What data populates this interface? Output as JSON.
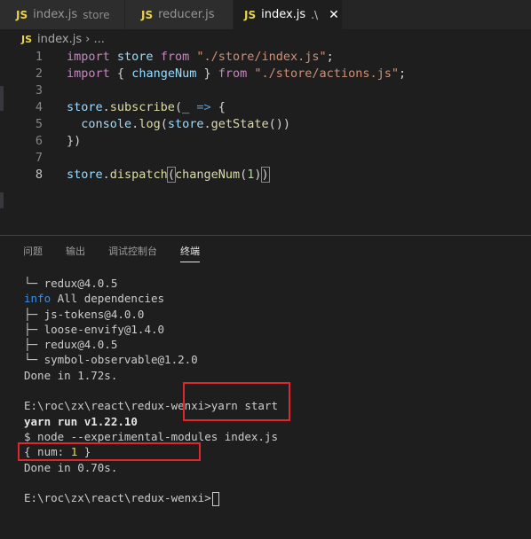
{
  "tabs": [
    {
      "label": "index.js",
      "desc": "store"
    },
    {
      "label": "reducer.js",
      "desc": ""
    },
    {
      "label": "index.js",
      "desc": ".\\"
    }
  ],
  "tab_icon": "JS",
  "close_glyph": "✕",
  "breadcrumb": {
    "file": "index.js",
    "rest": "›  ..."
  },
  "editor": {
    "line_numbers": [
      "1",
      "2",
      "3",
      "4",
      "5",
      "6",
      "7",
      "8"
    ],
    "l1": {
      "kw": "import",
      "var": "store",
      "kw2": "from",
      "str": "\"./store/index.js\"",
      "end": ";"
    },
    "l2": {
      "kw": "import",
      "open": "{ ",
      "fn": "changeNum",
      "close": " }",
      "kw2": "from",
      "str": "\"./store/actions.js\"",
      "end": ";"
    },
    "l4": {
      "var": "store",
      "dot": ".",
      "fn": "subscribe",
      "open": "(",
      "arg": "_",
      "arrow": "=>",
      "brace": "{"
    },
    "l5": {
      "var": "console",
      "dot": ".",
      "fn": "log",
      "open": "(",
      "var2": "store",
      "dot2": ".",
      "fn2": "getState",
      "close": "())"
    },
    "l6": {
      "text": "})"
    },
    "l8": {
      "var": "store",
      "dot": ".",
      "fn": "dispatch",
      "open": "(",
      "fn2": "changeNum",
      "open2": "(",
      "num": "1",
      "close2": ")",
      "close": ")"
    }
  },
  "panel_tabs": [
    "问题",
    "输出",
    "调试控制台",
    "终端"
  ],
  "terminal": {
    "lines": [
      "└─ redux@4.0.5",
      "",
      "├─ js-tokens@4.0.0",
      "├─ loose-envify@1.4.0",
      "├─ redux@4.0.5",
      "└─ symbol-observable@1.2.0",
      "Done in 1.72s.",
      "",
      "E:\\roc\\zx\\react\\redux-wenxi>yarn start",
      "yarn run v1.22.10",
      "$ node --experimental-modules index.js",
      "",
      "Done in 0.70s.",
      "",
      "E:\\roc\\zx\\react\\redux-wenxi>"
    ],
    "info_label": "info",
    "info_text": " All dependencies",
    "num_prefix": "{ num: ",
    "num_value": "1",
    "num_suffix": " }"
  },
  "colors": {
    "highlight_box": "#e0262d",
    "js_icon": "#e8d44d",
    "info": "#3b8eea"
  }
}
